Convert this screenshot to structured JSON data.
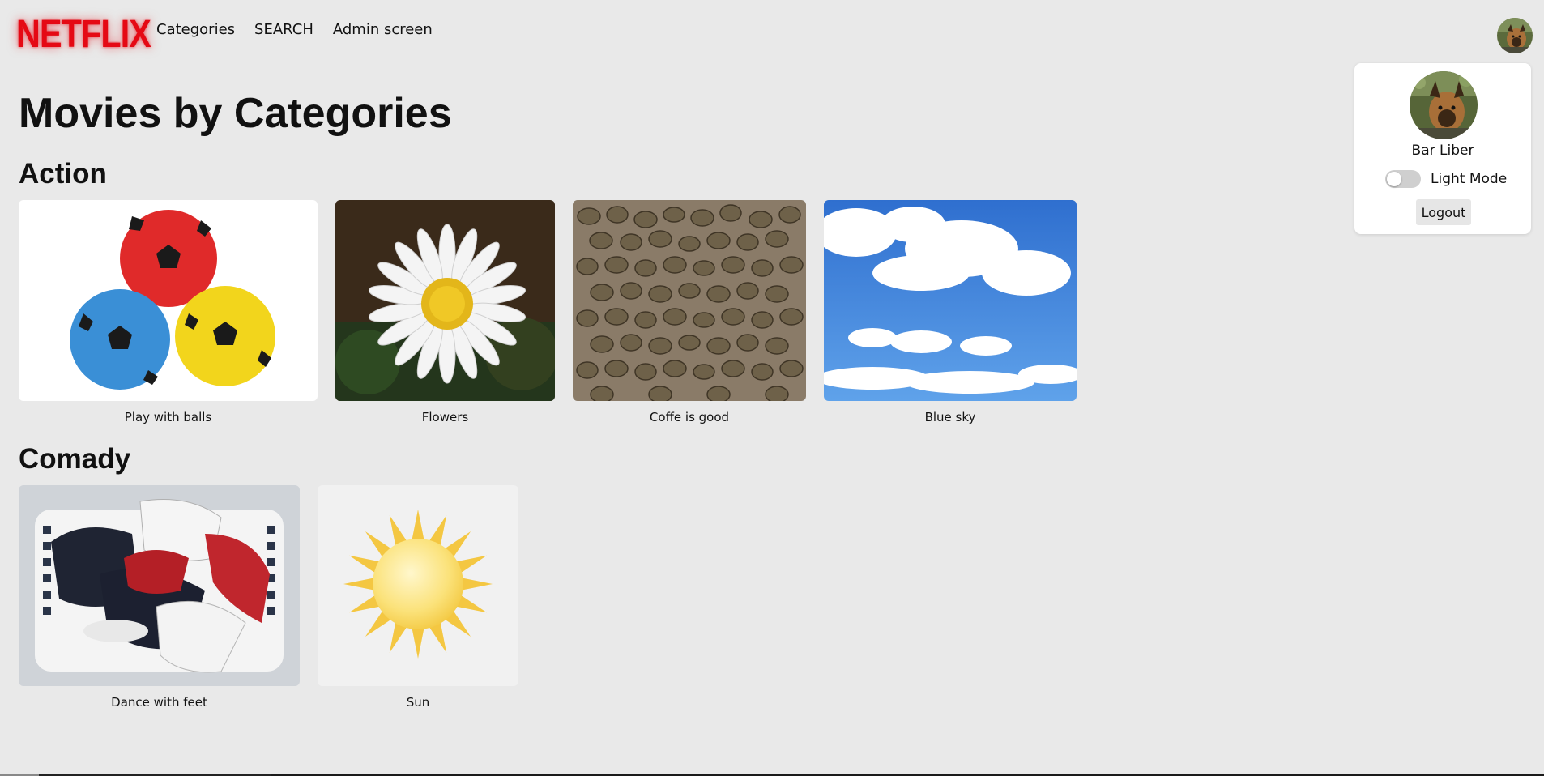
{
  "header": {
    "logo": "NETFLIX",
    "nav": [
      "Categories",
      "SEARCH",
      "Admin screen"
    ]
  },
  "user_menu": {
    "name": "Bar Liber",
    "toggle_label": "Light Mode",
    "toggle_on": false,
    "logout_label": "Logout"
  },
  "page": {
    "title": "Movies by Categories"
  },
  "categories": [
    {
      "name": "Action",
      "movies": [
        {
          "title": "Play with balls",
          "image": "balls-image"
        },
        {
          "title": "Flowers",
          "image": "daisy-image"
        },
        {
          "title": "Coffe is good",
          "image": "coffee-beans-image"
        },
        {
          "title": "Blue sky",
          "image": "sky-image"
        }
      ]
    },
    {
      "name": "Comady",
      "movies": [
        {
          "title": "Dance with feet",
          "image": "sneakers-image"
        },
        {
          "title": "Sun",
          "image": "sun-image"
        }
      ]
    }
  ],
  "colors": {
    "brand": "#e50914",
    "background": "#e9e9e9"
  }
}
